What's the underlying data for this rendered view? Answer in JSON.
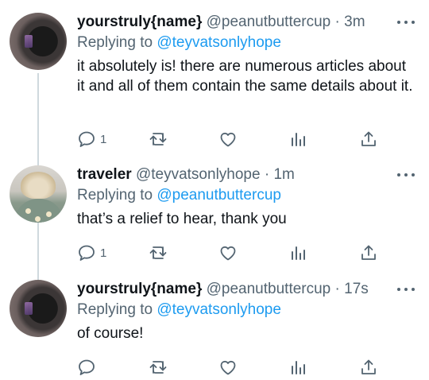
{
  "tweets": [
    {
      "name": "yourstruly{name}",
      "handle": "@peanutbuttercup",
      "separator": "·",
      "time": "3m",
      "replying_label": "Replying to",
      "replying_to": "@teyvatsonlyhope",
      "text": "it absolutely is! there are numerous articles about it and all of them contain the same details about it.",
      "reply_count": "1",
      "avatar": "dark-selfie-avatar"
    },
    {
      "name": "traveler",
      "handle": "@teyvatsonlyhope",
      "separator": "·",
      "time": "1m",
      "replying_label": "Replying to",
      "replying_to": "@peanutbuttercup",
      "text": "that’s a relief to hear, thank you",
      "reply_count": "1",
      "avatar": "blonde-hair-avatar"
    },
    {
      "name": "yourstruly{name}",
      "handle": "@peanutbuttercup",
      "separator": "·",
      "time": "17s",
      "replying_label": "Replying to",
      "replying_to": "@teyvatsonlyhope",
      "text": "of course!",
      "reply_count": "",
      "avatar": "dark-selfie-avatar"
    }
  ],
  "icons": {
    "reply": "reply-icon",
    "retweet": "retweet-icon",
    "like": "like-icon",
    "views": "views-icon",
    "share": "share-icon",
    "more": "more-icon"
  },
  "colors": {
    "text": "#0f1419",
    "secondary": "#536471",
    "link": "#1d9bf0",
    "thread_line": "#cfd9de"
  }
}
